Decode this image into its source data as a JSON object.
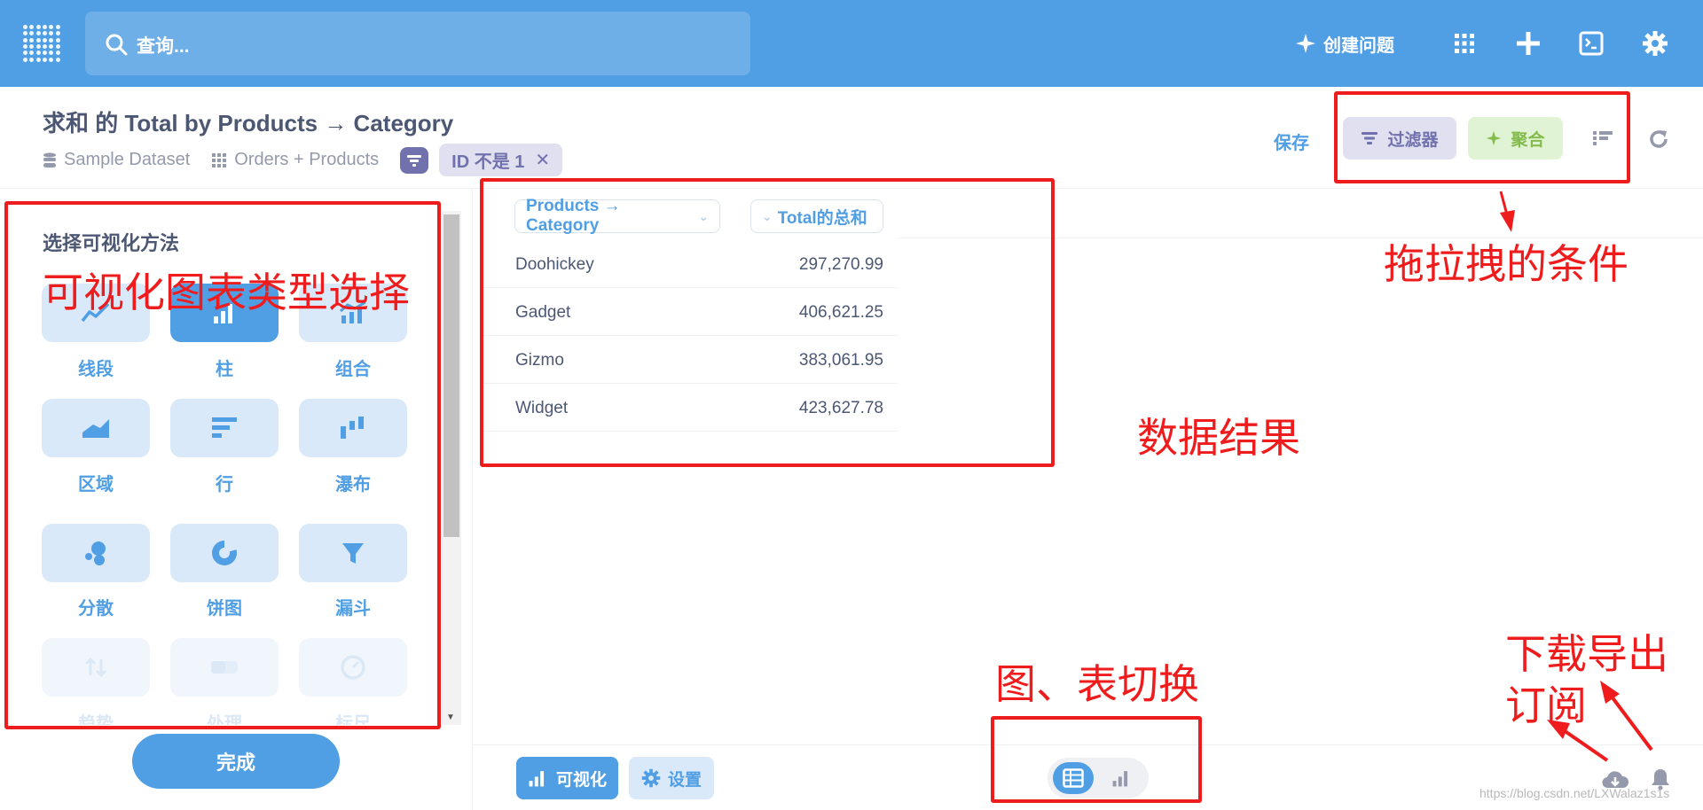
{
  "nav": {
    "search_placeholder": "查询...",
    "new_question": "创建问题"
  },
  "header": {
    "title": "求和 的 Total by Products → Category",
    "database": "Sample Dataset",
    "table": "Orders + Products",
    "filter_pill": "ID 不是 1",
    "save": "保存",
    "filter_button": "过滤器",
    "aggregate_button": "聚合"
  },
  "sidebar": {
    "title": "选择可视化方法",
    "types": [
      {
        "label": "线段",
        "icon": "line-chart-icon"
      },
      {
        "label": "柱",
        "icon": "bar-chart-icon",
        "selected": true
      },
      {
        "label": "组合",
        "icon": "combo-chart-icon"
      },
      {
        "label": "区域",
        "icon": "area-chart-icon"
      },
      {
        "label": "行",
        "icon": "row-chart-icon"
      },
      {
        "label": "瀑布",
        "icon": "waterfall-chart-icon"
      },
      {
        "label": "分散",
        "icon": "scatter-chart-icon"
      },
      {
        "label": "饼图",
        "icon": "pie-chart-icon"
      },
      {
        "label": "漏斗",
        "icon": "funnel-chart-icon"
      },
      {
        "label": "趋势",
        "icon": "trend-icon",
        "dim": true
      },
      {
        "label": "处理",
        "icon": "progress-icon",
        "dim": true
      },
      {
        "label": "标尺",
        "icon": "gauge-icon",
        "dim": true
      }
    ],
    "done": "完成"
  },
  "table": {
    "columns": [
      "Products → Category",
      "Total的总和"
    ],
    "rows": [
      [
        "Doohickey",
        "297,270.99"
      ],
      [
        "Gadget",
        "406,621.25"
      ],
      [
        "Gizmo",
        "383,061.95"
      ],
      [
        "Widget",
        "423,627.78"
      ]
    ]
  },
  "footer": {
    "visualize": "可视化",
    "settings": "设置"
  },
  "annotations": {
    "viz_types": "可视化图表类型选择",
    "drag_conditions": "拖拉拽的条件",
    "data_result": "数据结果",
    "chart_table_switch": "图、表切换",
    "download_export": "下载导出",
    "subscribe": "订阅"
  },
  "watermark": "https://blog.csdn.net/LXWalaz1s1s",
  "colors": {
    "brand": "#509ee3",
    "filter": "#7172ad",
    "aggregate": "#84bb4c",
    "annotation": "#ee1c1c"
  }
}
